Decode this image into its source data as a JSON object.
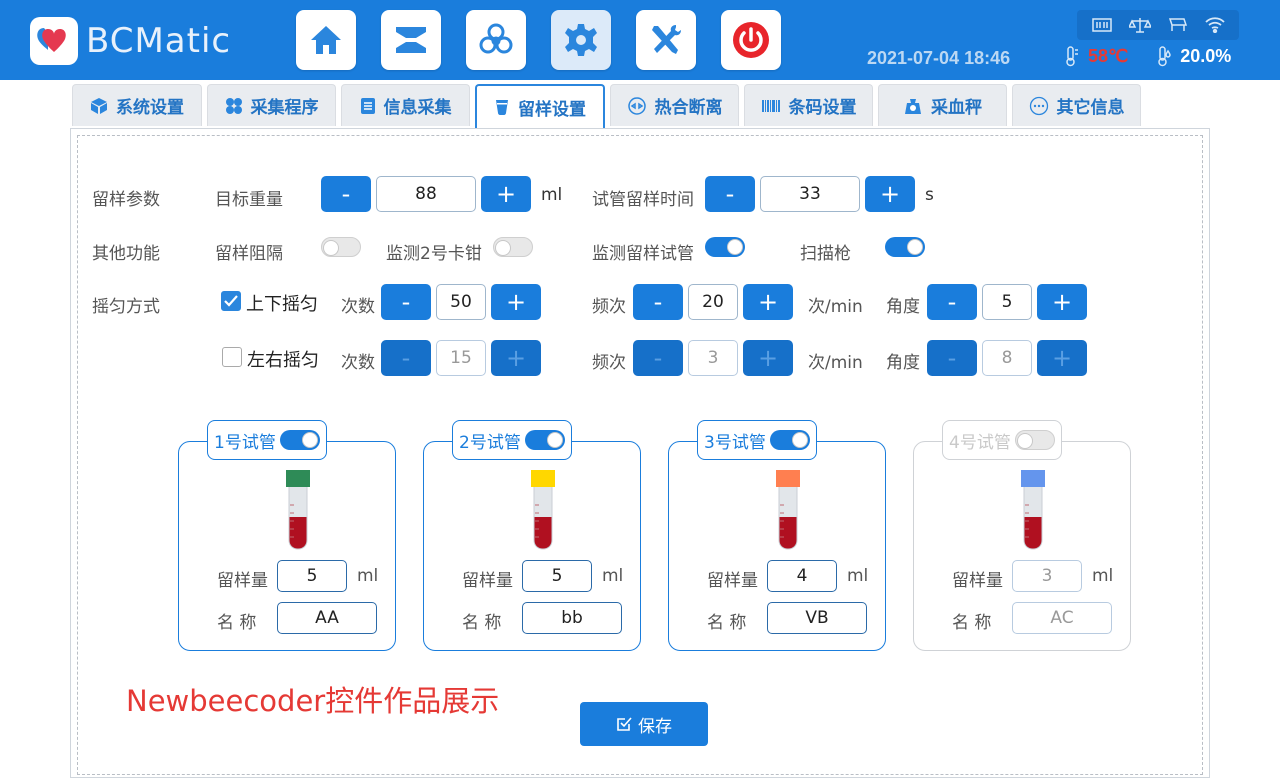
{
  "header": {
    "logo_text": "BCMatic",
    "datetime": "2021-07-04 18:46",
    "temperature": "58℃",
    "humidity": "20.0%",
    "tools": [
      "home-icon",
      "layers-icon",
      "biohazard-icon",
      "gear-icon",
      "wrench-screwdriver-icon",
      "power-icon"
    ]
  },
  "tabs": [
    {
      "label": "系统设置",
      "icon": "cube-icon"
    },
    {
      "label": "采集程序",
      "icon": "grid-icon"
    },
    {
      "label": "信息采集",
      "icon": "list-icon"
    },
    {
      "label": "留样设置",
      "icon": "cup-icon",
      "active": true
    },
    {
      "label": "热合断离",
      "icon": "link-icon"
    },
    {
      "label": "条码设置",
      "icon": "barcode-icon"
    },
    {
      "label": "采血秤",
      "icon": "scale-icon"
    },
    {
      "label": "其它信息",
      "icon": "more-icon"
    }
  ],
  "params": {
    "section_label": "留样参数",
    "target_weight_label": "目标重量",
    "target_weight": "88",
    "target_weight_unit": "ml",
    "tube_time_label": "试管留样时间",
    "tube_time": "33",
    "tube_time_unit": "s",
    "minus": "-",
    "plus": "+"
  },
  "functions": {
    "section_label": "其他功能",
    "block_label": "留样阻隔",
    "block_on": false,
    "monitor_clamp_label": "监测2号卡钳",
    "monitor_clamp_on": false,
    "monitor_tube_label": "监测留样试管",
    "monitor_tube_on": true,
    "scanner_label": "扫描枪",
    "scanner_on": true
  },
  "shake": {
    "section_label": "摇匀方式",
    "count_label": "次数",
    "freq_label": "频次",
    "freq_unit": "次/min",
    "angle_label": "角度",
    "vertical": {
      "label": "上下摇匀",
      "checked": true,
      "count": "50",
      "freq": "20",
      "angle": "5"
    },
    "horizontal": {
      "label": "左右摇匀",
      "checked": false,
      "count": "15",
      "freq": "3",
      "angle": "8"
    }
  },
  "tubes": [
    {
      "title": "1号试管",
      "enabled": true,
      "cap_color": "#2e8b57",
      "amount_label": "留样量",
      "amount": "5",
      "unit": "ml",
      "name_label": "名 称",
      "name": "AA"
    },
    {
      "title": "2号试管",
      "enabled": true,
      "cap_color": "#ffd700",
      "amount_label": "留样量",
      "amount": "5",
      "unit": "ml",
      "name_label": "名 称",
      "name": "bb"
    },
    {
      "title": "3号试管",
      "enabled": true,
      "cap_color": "#ff7f50",
      "amount_label": "留样量",
      "amount": "4",
      "unit": "ml",
      "name_label": "名 称",
      "name": "VB"
    },
    {
      "title": "4号试管",
      "enabled": false,
      "cap_color": "#6495ed",
      "amount_label": "留样量",
      "amount": "3",
      "unit": "ml",
      "name_label": "名 称",
      "name": "AC"
    }
  ],
  "watermark": "Newbeecoder控件作品展示",
  "save_label": "保存",
  "colors": {
    "accent": "#1a7ddc",
    "temp": "#e53935",
    "watermark": "#e53935"
  }
}
